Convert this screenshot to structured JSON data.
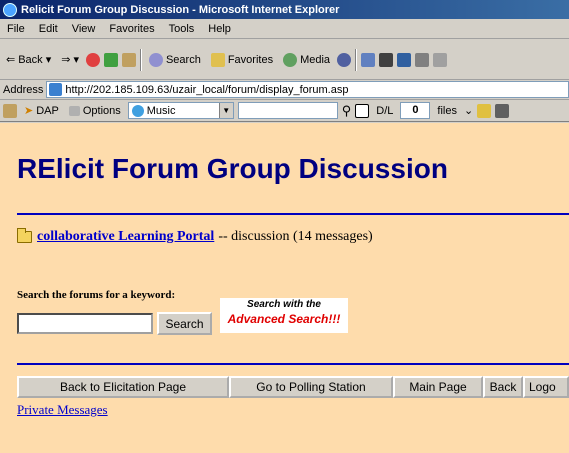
{
  "window": {
    "title": "Relicit Forum Group Discussion - Microsoft Internet Explorer"
  },
  "menu": [
    "File",
    "Edit",
    "View",
    "Favorites",
    "Tools",
    "Help"
  ],
  "toolbar": {
    "back_label": "Back",
    "search_label": "Search",
    "favorites_label": "Favorites",
    "media_label": "Media"
  },
  "address": {
    "label": "Address",
    "url": "http://202.185.109.63/uzair_local/forum/display_forum.asp"
  },
  "links_toolbar": {
    "dap_label": "DAP",
    "options_label": "Options",
    "music_label": "Music",
    "dl_label": "D/L",
    "dl_count": "0",
    "files_label": "files"
  },
  "page": {
    "title": "RElicit Forum Group Discussion",
    "forum_link": "collaborative Learning Portal",
    "forum_desc": "-- discussion (14 messages)",
    "search_label": "Search the forums for a keyword:",
    "search_button": "Search",
    "advanced_line1": "Search with the",
    "advanced_line2": "Advanced Search!!!",
    "nav": [
      "Back to Elicitation Page",
      "Go to Polling Station",
      "Main Page",
      "Back",
      "Logo"
    ],
    "private_messages": "Private Messages"
  },
  "colors": {
    "page_bg": "#fedcac",
    "title": "#000080",
    "rule": "#0000c0",
    "link": "#0000cc",
    "advanced": "#e00000"
  }
}
